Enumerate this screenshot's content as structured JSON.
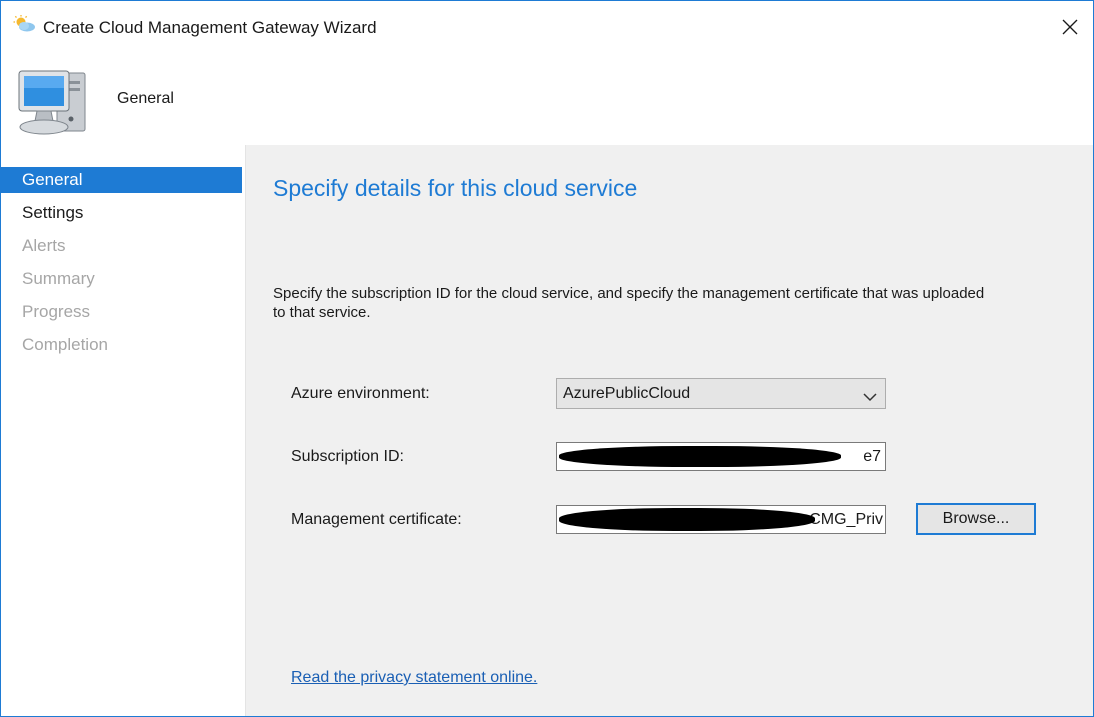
{
  "window": {
    "title": "Create Cloud Management Gateway Wizard",
    "accent_color": "#1e7bd4"
  },
  "header": {
    "title": "General",
    "icon": "computer-icon"
  },
  "nav": {
    "items": [
      {
        "label": "General",
        "state": "active"
      },
      {
        "label": "Settings",
        "state": "enabled"
      },
      {
        "label": "Alerts",
        "state": "disabled"
      },
      {
        "label": "Summary",
        "state": "disabled"
      },
      {
        "label": "Progress",
        "state": "disabled"
      },
      {
        "label": "Completion",
        "state": "disabled"
      }
    ]
  },
  "main": {
    "heading": "Specify details for this cloud service",
    "description": "Specify the subscription ID for the cloud service, and specify the management certificate that was uploaded to that service.",
    "azure_environment": {
      "label": "Azure environment:",
      "value": "AzurePublicCloud"
    },
    "subscription_id": {
      "label": "Subscription ID:",
      "visible_value": "e7"
    },
    "management_certificate": {
      "label": "Management certificate:",
      "visible_value": "CMG_Priv"
    },
    "browse_label": "Browse...",
    "privacy_link": "Read the privacy statement online."
  }
}
